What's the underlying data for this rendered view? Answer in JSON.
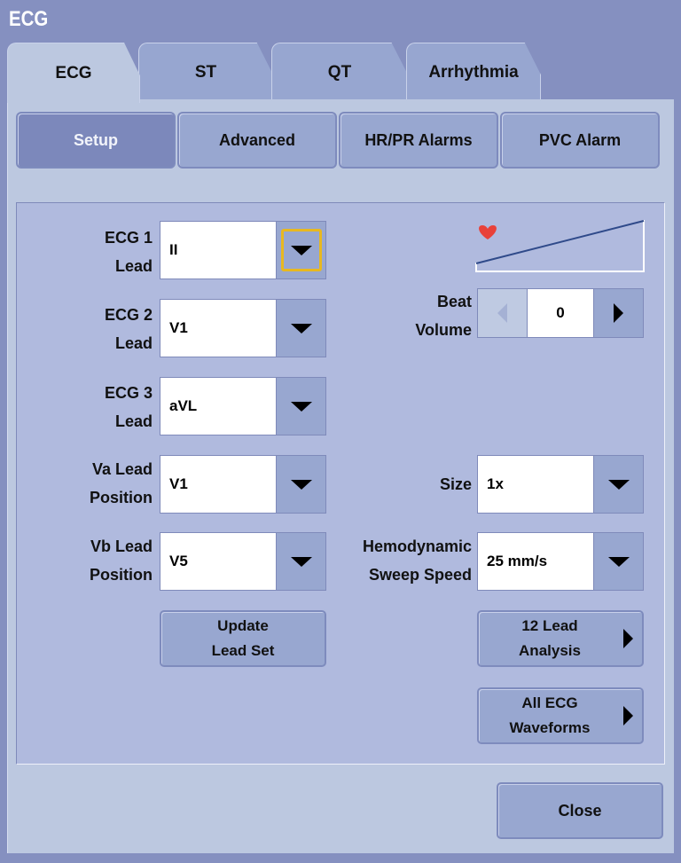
{
  "window": {
    "title": "ECG"
  },
  "tabs": [
    {
      "label": "ECG",
      "active": true
    },
    {
      "label": "ST"
    },
    {
      "label": "QT"
    },
    {
      "label": "Arrhythmia"
    }
  ],
  "subtabs": [
    {
      "label": "Setup",
      "selected": true
    },
    {
      "label": "Advanced"
    },
    {
      "label": "HR/PR Alarms"
    },
    {
      "label": "PVC Alarm"
    }
  ],
  "leads": [
    {
      "label1": "ECG 1",
      "label2": "Lead",
      "value": "II",
      "focused": true
    },
    {
      "label1": "ECG 2",
      "label2": "Lead",
      "value": "V1"
    },
    {
      "label1": "ECG 3",
      "label2": "Lead",
      "value": "aVL"
    },
    {
      "label1": "Va Lead",
      "label2": "Position",
      "value": "V1"
    },
    {
      "label1": "Vb Lead",
      "label2": "Position",
      "value": "V5"
    }
  ],
  "update_button": {
    "line1": "Update",
    "line2": "Lead Set"
  },
  "beat_volume": {
    "label1": "Beat",
    "label2": "Volume",
    "value": "0",
    "heart_color": "#e8413a"
  },
  "size": {
    "label": "Size",
    "value": "1x"
  },
  "sweep": {
    "label1": "Hemodynamic",
    "label2": "Sweep Speed",
    "value": "25 mm/s"
  },
  "twelve_lead": {
    "line1": "12 Lead",
    "line2": "Analysis"
  },
  "all_waveforms": {
    "line1": "All ECG",
    "line2": "Waveforms"
  },
  "close_label": "Close",
  "colors": {
    "focus": "#e8b820",
    "accent": "#7c88bb"
  }
}
